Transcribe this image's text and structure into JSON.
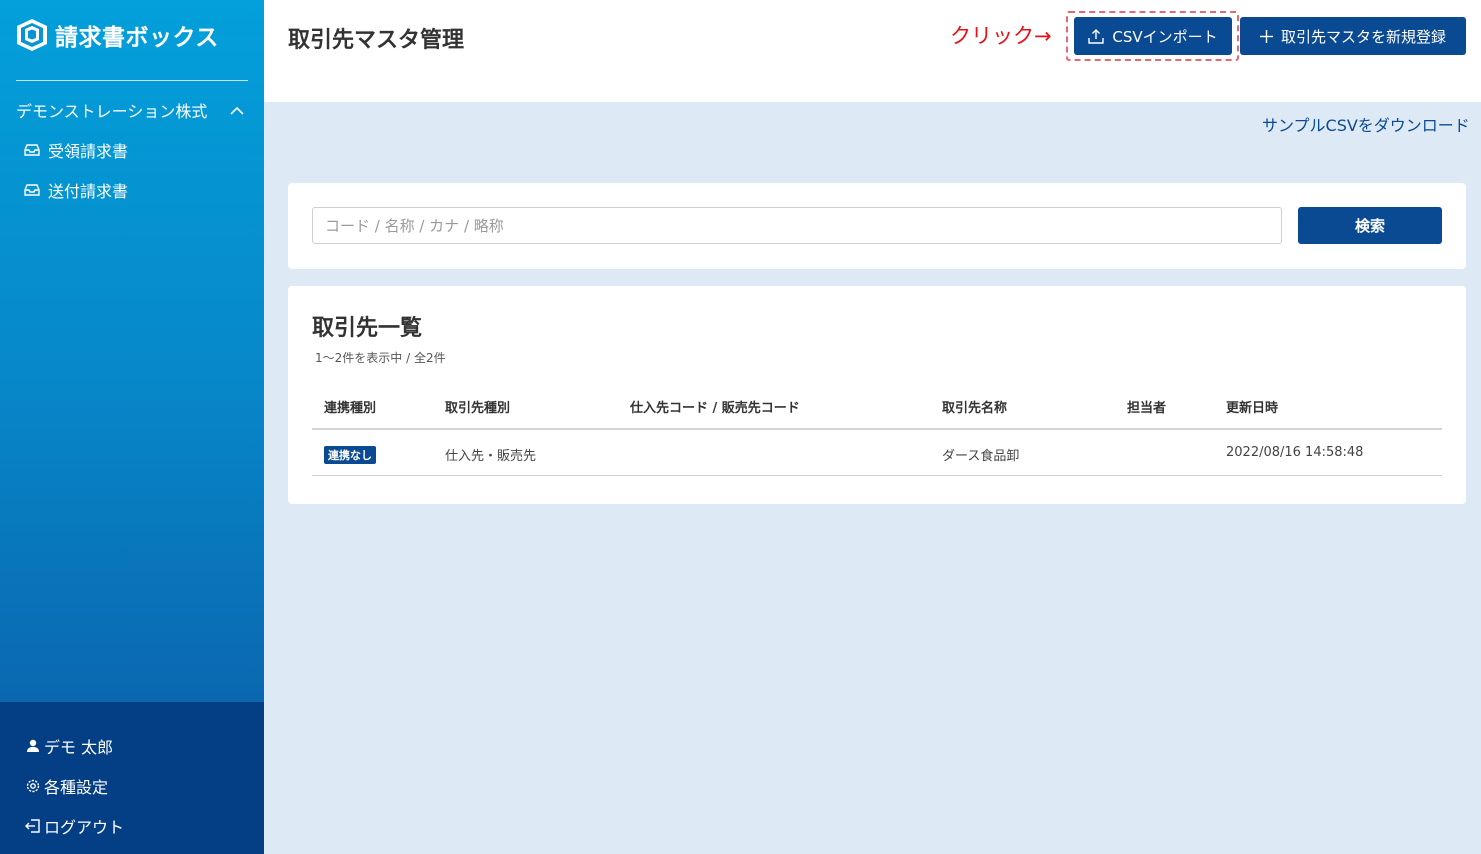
{
  "app": {
    "name": "請求書ボックス"
  },
  "sidebar": {
    "company": "デモンストレーション株式",
    "items": [
      {
        "label": "受領請求書",
        "icon": "inbox-icon"
      },
      {
        "label": "送付請求書",
        "icon": "inbox-icon"
      }
    ],
    "bottom": [
      {
        "label": "デモ 太郎",
        "icon": "user-icon"
      },
      {
        "label": "各種設定",
        "icon": "gear-icon"
      },
      {
        "label": "ログアウト",
        "icon": "logout-icon"
      }
    ]
  },
  "header": {
    "title": "取引先マスタ管理",
    "annotation": "クリック→",
    "import_label": "CSVインポート",
    "new_label": "取引先マスタを新規登録"
  },
  "sample_link": "サンプルCSVをダウンロード",
  "search": {
    "placeholder": "コード / 名称 / カナ / 略称",
    "value": "",
    "button": "検索"
  },
  "list": {
    "title": "取引先一覧",
    "count": "1〜2件を表示中 / 全2件",
    "columns": [
      "連携種別",
      "取引先種別",
      "仕入先コード / 販売先コード",
      "取引先名称",
      "担当者",
      "更新日時"
    ],
    "rows": [
      {
        "link_type": "連携なし",
        "partner_type": "仕入先・販売先",
        "code": "",
        "name": "ダース食品卸",
        "person": "",
        "updated": "2022/08/16 14:58:48"
      }
    ]
  },
  "colors": {
    "primary": "#0a4a93",
    "sidebar_top": "#03a0db",
    "sidebar_bottom": "#043e85",
    "annotation": "#e8101a",
    "background": "#dde9f5"
  }
}
